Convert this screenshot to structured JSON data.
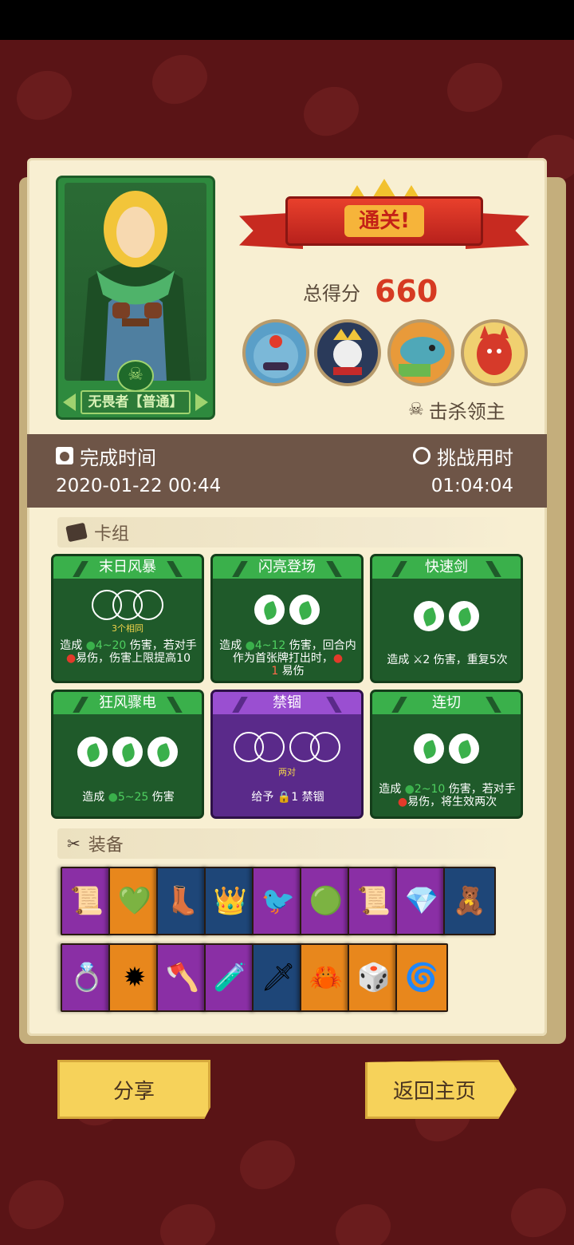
{
  "hero": {
    "name": "无畏者【普通】"
  },
  "result": {
    "banner": "通关!",
    "score_label": "总得分",
    "score_value": "660",
    "kill_label": "击杀领主",
    "bosses": [
      "blue-ogre-boss",
      "skull-king-boss",
      "fish-king-boss",
      "red-demon-boss"
    ]
  },
  "time": {
    "finish_label": "完成时间",
    "finish_value": "2020-01-22 00:44",
    "duration_label": "挑战用时",
    "duration_value": "01:04:04"
  },
  "deck": {
    "title": "卡组",
    "cards": [
      {
        "name": "末日风暴",
        "dice_note": "3个相同",
        "desc_a": "造成 ",
        "desc_value": "4~20",
        "desc_b": " 伤害，若对手",
        "desc_c": "易伤，伤害上限提高10",
        "color": "green"
      },
      {
        "name": "闪亮登场",
        "desc_a": "造成 ",
        "desc_value": "4~12",
        "desc_b": " 伤害，回合内作为首张牌打出时，",
        "desc_value2": "1",
        "desc_c": " 易伤",
        "color": "green"
      },
      {
        "name": "快速剑",
        "desc_a": "造成 ",
        "desc_b": "2 伤害，重复5次",
        "color": "green"
      },
      {
        "name": "狂风骤电",
        "desc_a": "造成 ",
        "desc_value": "5~25",
        "desc_b": " 伤害",
        "color": "green"
      },
      {
        "name": "禁锢",
        "dice_note": "两对",
        "desc_a": "给予 ",
        "desc_b": "1 禁锢",
        "color": "purple"
      },
      {
        "name": "连切",
        "desc_a": "造成 ",
        "desc_value": "2~10",
        "desc_b": " 伤害，若对手",
        "desc_c": "易伤，将生效两次",
        "color": "green"
      }
    ]
  },
  "equipment": {
    "title": "装备",
    "row1": [
      {
        "icon": "scroll-icon",
        "color": "purple"
      },
      {
        "icon": "green-gem-icon",
        "color": "orange"
      },
      {
        "icon": "boot-icon",
        "color": "blue"
      },
      {
        "icon": "ice-crown-icon",
        "color": "blue"
      },
      {
        "icon": "green-bird-icon",
        "color": "purple"
      },
      {
        "icon": "green-orb-icon",
        "color": "purple"
      },
      {
        "icon": "scroll-icon",
        "color": "purple"
      },
      {
        "icon": "crystal-icon",
        "color": "purple"
      },
      {
        "icon": "voodoo-doll-icon",
        "color": "blue"
      }
    ],
    "row2": [
      {
        "icon": "ring-icon",
        "color": "purple"
      },
      {
        "icon": "spiked-ball-icon",
        "color": "orange"
      },
      {
        "icon": "axe-icon",
        "color": "purple"
      },
      {
        "icon": "potion-icon",
        "color": "purple"
      },
      {
        "icon": "skull-dagger-icon",
        "color": "blue"
      },
      {
        "icon": "crab-icon",
        "color": "orange"
      },
      {
        "icon": "green-die-icon",
        "color": "orange"
      },
      {
        "icon": "swirl-icon",
        "color": "orange"
      }
    ]
  },
  "buttons": {
    "share": "分享",
    "home": "返回主页"
  }
}
